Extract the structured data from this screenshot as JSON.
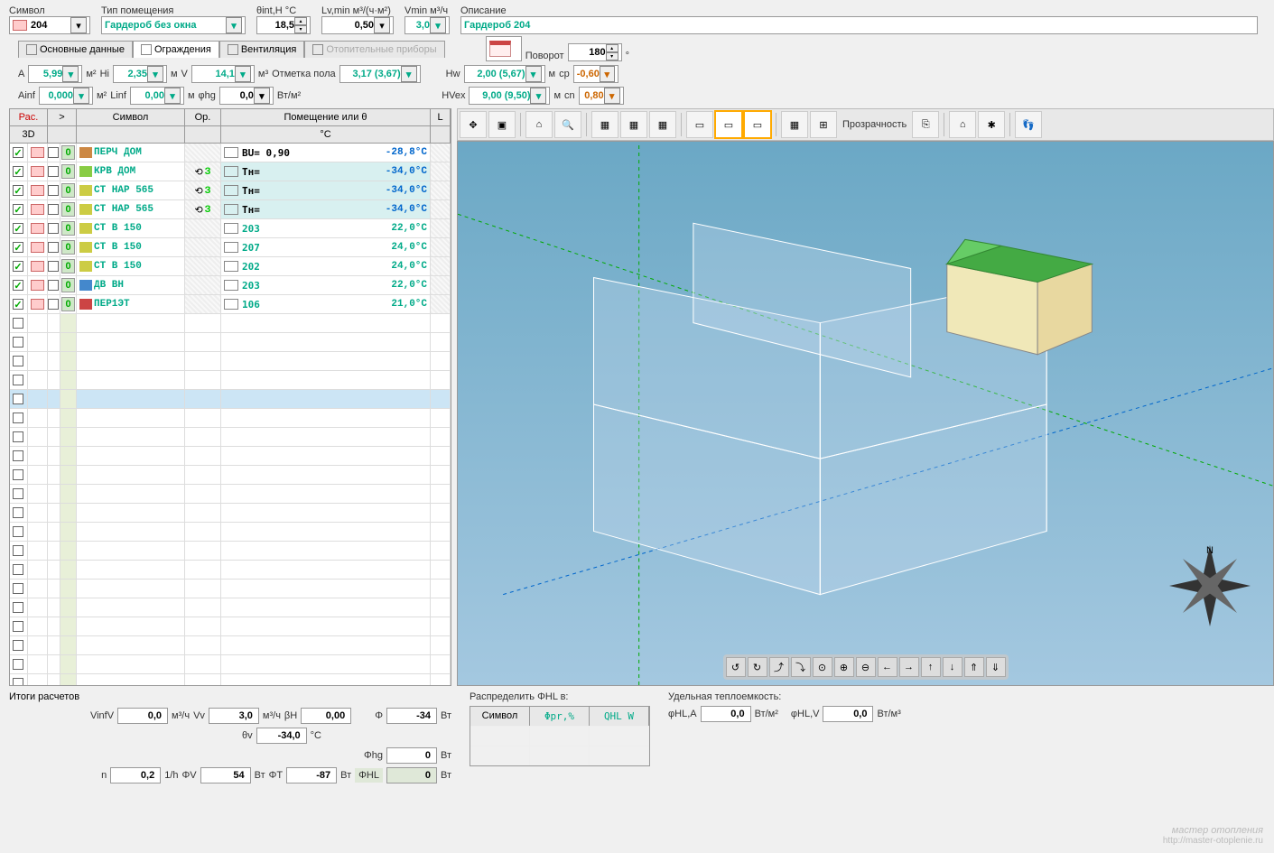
{
  "top_fields": {
    "symbol": {
      "label": "Символ",
      "value": "204"
    },
    "room_type": {
      "label": "Тип помещения",
      "value": "Гардероб без окна"
    },
    "theta": {
      "label": "θint,H °C",
      "value": "18,5"
    },
    "lvmin": {
      "label": "Lv,min м³/(ч·м²)",
      "value": "0,50"
    },
    "vmin": {
      "label": "Vmin м³/ч",
      "value": "3,0"
    },
    "description": {
      "label": "Описание",
      "value": "Гардероб 204"
    }
  },
  "tabs": [
    {
      "label": "Основные данные",
      "active": false
    },
    {
      "label": "Ограждения",
      "active": true
    },
    {
      "label": "Вентиляция",
      "active": false
    },
    {
      "label": "Отопительные приборы",
      "disabled": true
    }
  ],
  "rotation": {
    "label": "Поворот",
    "value": "180",
    "unit": "°"
  },
  "params1": {
    "A": {
      "label": "A",
      "value": "5,99",
      "unit": "м²"
    },
    "Hi": {
      "label": "Hi",
      "value": "2,35",
      "unit": "м"
    },
    "V": {
      "label": "V",
      "value": "14,1",
      "unit": "м³"
    },
    "mark": {
      "label": "Отметка пола",
      "value": "3,17 (3,67)"
    },
    "Hw": {
      "label": "Hw",
      "value": "2,00 (5,67)",
      "unit": "м"
    },
    "cp": {
      "label": "cp",
      "value": "-0,60"
    }
  },
  "params2": {
    "Ainf": {
      "label": "Ainf",
      "value": "0,000",
      "unit": "м²"
    },
    "Linf": {
      "label": "Linf",
      "value": "0,00",
      "unit": "м"
    },
    "phg": {
      "label": "φhg",
      "value": "0,0",
      "unit": "Вт/м²"
    },
    "HVex": {
      "label": "HVex",
      "value": "9,00 (9,50)",
      "unit": "м"
    },
    "cn": {
      "label": "cn",
      "value": "0,80"
    }
  },
  "table": {
    "headers": {
      "rac": "Рас.",
      "gt": ">",
      "symbol": "Символ",
      "op": "Ор.",
      "room": "Помещение или θ",
      "L": "L"
    },
    "sub": {
      "3d": "3D",
      "c": "°C"
    },
    "rows": [
      {
        "checked": true,
        "n": "0",
        "icon": "roof",
        "sym": "ПЕРЧ ДОМ",
        "op": "",
        "room_icon": "temp",
        "room": "BU= 0,90",
        "temp": "-28,8°C",
        "neg": true
      },
      {
        "checked": true,
        "n": "0",
        "icon": "roof2",
        "sym": "КРВ ДОМ",
        "op": "З",
        "room_icon": "temp",
        "room": "Tн=",
        "temp": "-34,0°C",
        "neg": true,
        "bg": "cyan"
      },
      {
        "checked": true,
        "n": "0",
        "icon": "wall",
        "sym": "СТ НАР 565",
        "op": "З",
        "room_icon": "temp",
        "room": "Tн=",
        "temp": "-34,0°C",
        "neg": true,
        "bg": "cyan"
      },
      {
        "checked": true,
        "n": "0",
        "icon": "wall",
        "sym": "СТ НАР 565",
        "op": "З",
        "room_icon": "temp",
        "room": "Tн=",
        "temp": "-34,0°C",
        "neg": true,
        "bg": "cyan"
      },
      {
        "checked": true,
        "n": "0",
        "icon": "wall2",
        "sym": "СТ В 150",
        "op": "",
        "room_icon": "room",
        "room": "203",
        "temp": "22,0°C",
        "neg": false
      },
      {
        "checked": true,
        "n": "0",
        "icon": "wall2",
        "sym": "СТ В 150",
        "op": "",
        "room_icon": "room",
        "room": "207",
        "temp": "24,0°C",
        "neg": false
      },
      {
        "checked": true,
        "n": "0",
        "icon": "wall2",
        "sym": "СТ В 150",
        "op": "",
        "room_icon": "room",
        "room": "202",
        "temp": "24,0°C",
        "neg": false
      },
      {
        "checked": true,
        "n": "0",
        "icon": "door",
        "sym": "ДВ ВН",
        "op": "",
        "room_icon": "room",
        "room": "203",
        "temp": "22,0°C",
        "neg": false
      },
      {
        "checked": true,
        "n": "0",
        "icon": "floor",
        "sym": "ПЕР1ЭТ",
        "op": "",
        "room_icon": "room",
        "room": "106",
        "temp": "21,0°C",
        "neg": false
      }
    ],
    "empty_rows": 21
  },
  "toolbar_transparency": "Прозрачность",
  "results": {
    "title": "Итоги расчетов",
    "VinfV": {
      "label": "VinfV",
      "value": "0,0",
      "unit": "м³/ч"
    },
    "Vv": {
      "label": "Vv",
      "value": "3,0",
      "unit": "м³/ч"
    },
    "BH": {
      "label": "βH",
      "value": "0,00"
    },
    "Phi": {
      "label": "Φ",
      "value": "-34",
      "unit": "Вт"
    },
    "theta_v": {
      "label": "θv",
      "value": "-34,0",
      "unit": "°C"
    },
    "Phi_hg": {
      "label": "Φhg",
      "value": "0",
      "unit": "Вт"
    },
    "n": {
      "label": "n",
      "value": "0,2",
      "unit": "1/h"
    },
    "PhiV": {
      "label": "ΦV",
      "value": "54",
      "unit": "Вт"
    },
    "PhiT": {
      "label": "ΦT",
      "value": "-87",
      "unit": "Вт"
    },
    "PhiHL": {
      "label": "ΦHL",
      "value": "0",
      "unit": "Вт"
    }
  },
  "distribute": {
    "title": "Распределить ΦHL в:",
    "headers": {
      "symbol": "Символ",
      "phi_pr": "Φpr,%",
      "qhl": "QHL W"
    }
  },
  "specific": {
    "title": "Удельная теплоемкость:",
    "phiHLA": {
      "label": "φHL,A",
      "value": "0,0",
      "unit": "Вт/м²"
    },
    "phiHLV": {
      "label": "φHL,V",
      "value": "0,0",
      "unit": "Вт/м³"
    }
  },
  "watermark": {
    "main": "мастер отопления",
    "url": "http://master-otoplenie.ru"
  }
}
